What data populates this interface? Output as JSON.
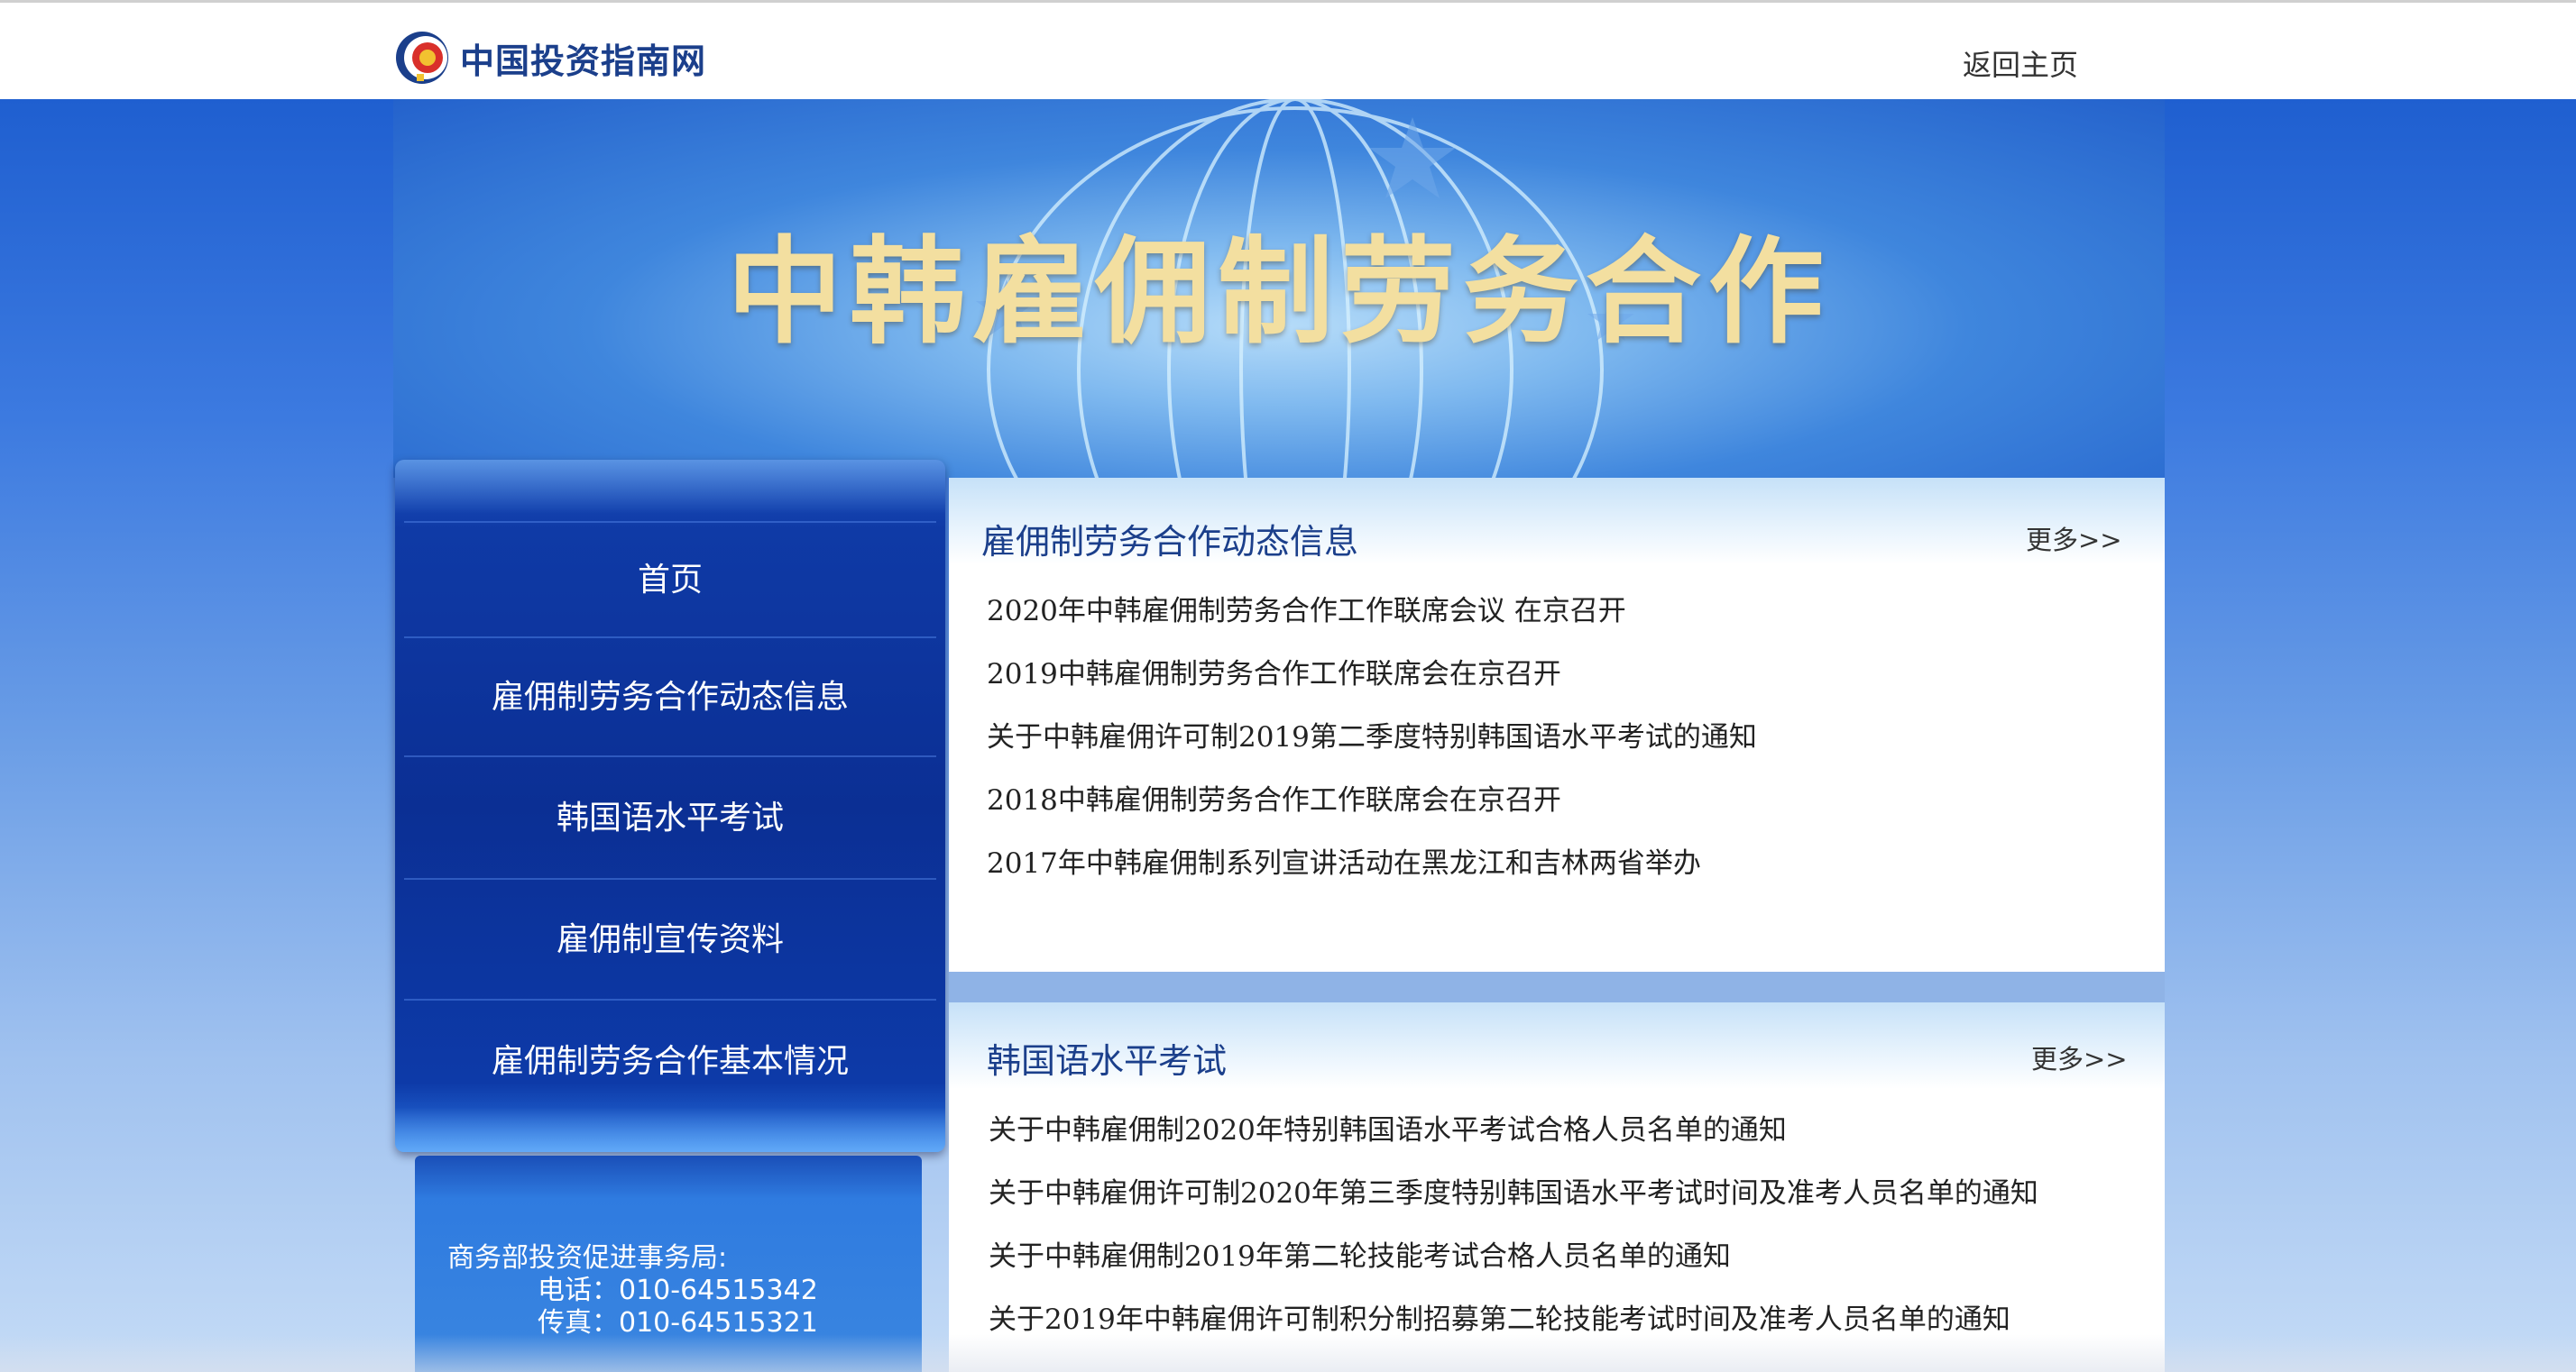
{
  "header": {
    "site_name": "中国投资指南网",
    "home_link": "返回主页"
  },
  "banner": {
    "title": "中韩雇佣制劳务合作"
  },
  "sidebar": {
    "items": [
      {
        "label": "首页"
      },
      {
        "label": "雇佣制劳务合作动态信息"
      },
      {
        "label": "韩国语水平考试"
      },
      {
        "label": "雇佣制宣传资料"
      },
      {
        "label": "雇佣制劳务合作基本情况"
      }
    ]
  },
  "contact": {
    "org": "商务部投资促进事务局:",
    "phone": "电话：010-64515342",
    "fax": "传真：010-64515321"
  },
  "panels": [
    {
      "title": "雇佣制劳务合作动态信息",
      "more": "更多>>",
      "items": [
        "2020年中韩雇佣制劳务合作工作联席会议 在京召开",
        "2019中韩雇佣制劳务合作工作联席会在京召开",
        "关于中韩雇佣许可制2019第二季度特别韩国语水平考试的通知",
        "2018中韩雇佣制劳务合作工作联席会在京召开",
        "2017年中韩雇佣制系列宣讲活动在黑龙江和吉林两省举办"
      ]
    },
    {
      "title": "韩国语水平考试",
      "more": "更多>>",
      "items": [
        "关于中韩雇佣制2020年特别韩国语水平考试合格人员名单的通知",
        "关于中韩雇佣许可制2020年第三季度特别韩国语水平考试时间及准考人员名单的通知",
        "关于中韩雇佣制2019年第二轮技能考试合格人员名单的通知",
        "关于2019年中韩雇佣许可制积分制招募第二轮技能考试时间及准考人员名单的通知"
      ]
    }
  ],
  "colors": {
    "nav_blue": "#0b2f94",
    "title_blue": "#1b3f8b",
    "banner_gold": "#f3dfa0"
  }
}
